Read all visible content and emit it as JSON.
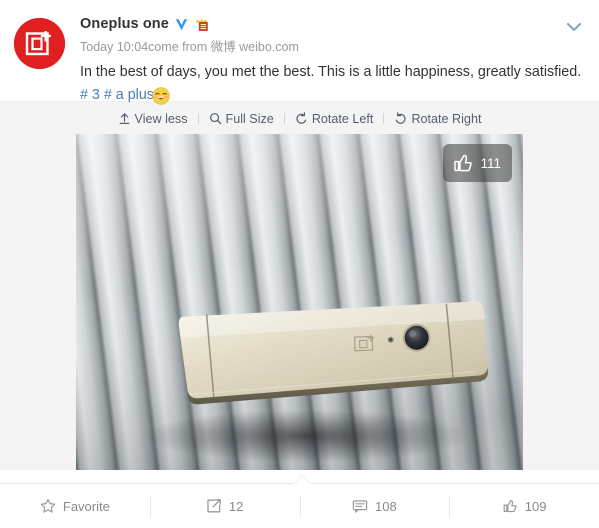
{
  "post": {
    "username": "Oneplus one",
    "verified_badge": "V",
    "meta_time": "Today 10:04",
    "meta_source_prefix": "come from ",
    "meta_source_cn": "微博",
    "meta_source_link": "weibo.com",
    "body_text": "In the best of days, you met the best. This is a little happiness, greatly satisfied.",
    "tag_text": "# 3 # a plus",
    "emoji": "squinting-smile",
    "avatar_brand": "oneplus-logo",
    "collapse_icon": "chevron-down-icon"
  },
  "image_toolbar": {
    "items": [
      {
        "label": "View less",
        "icon": "collapse-up-icon"
      },
      {
        "label": "Full Size",
        "icon": "magnifier-icon"
      },
      {
        "label": "Rotate Left",
        "icon": "rotate-left-icon"
      },
      {
        "label": "Rotate Right",
        "icon": "rotate-right-icon"
      }
    ]
  },
  "media": {
    "alt": "Gold OnePlus 3 smartphone lying face down on a grey ribbed metal surface",
    "like_overlay": {
      "icon": "thumbs-up-icon",
      "count": "111"
    }
  },
  "footer": {
    "items": [
      {
        "icon": "star-icon",
        "label": "Favorite"
      },
      {
        "icon": "share-icon",
        "label": "12"
      },
      {
        "icon": "comment-icon",
        "label": "108"
      },
      {
        "icon": "thumbs-up-icon",
        "label": "109"
      }
    ]
  },
  "colors": {
    "brand_red": "#e02020",
    "link_blue": "#4a7cb5",
    "verified_blue": "#3399ee",
    "text_primary": "#333333",
    "text_muted": "#9a9a9a",
    "toolbar_text": "#55606e",
    "panel_bg": "#f4f4f4"
  }
}
